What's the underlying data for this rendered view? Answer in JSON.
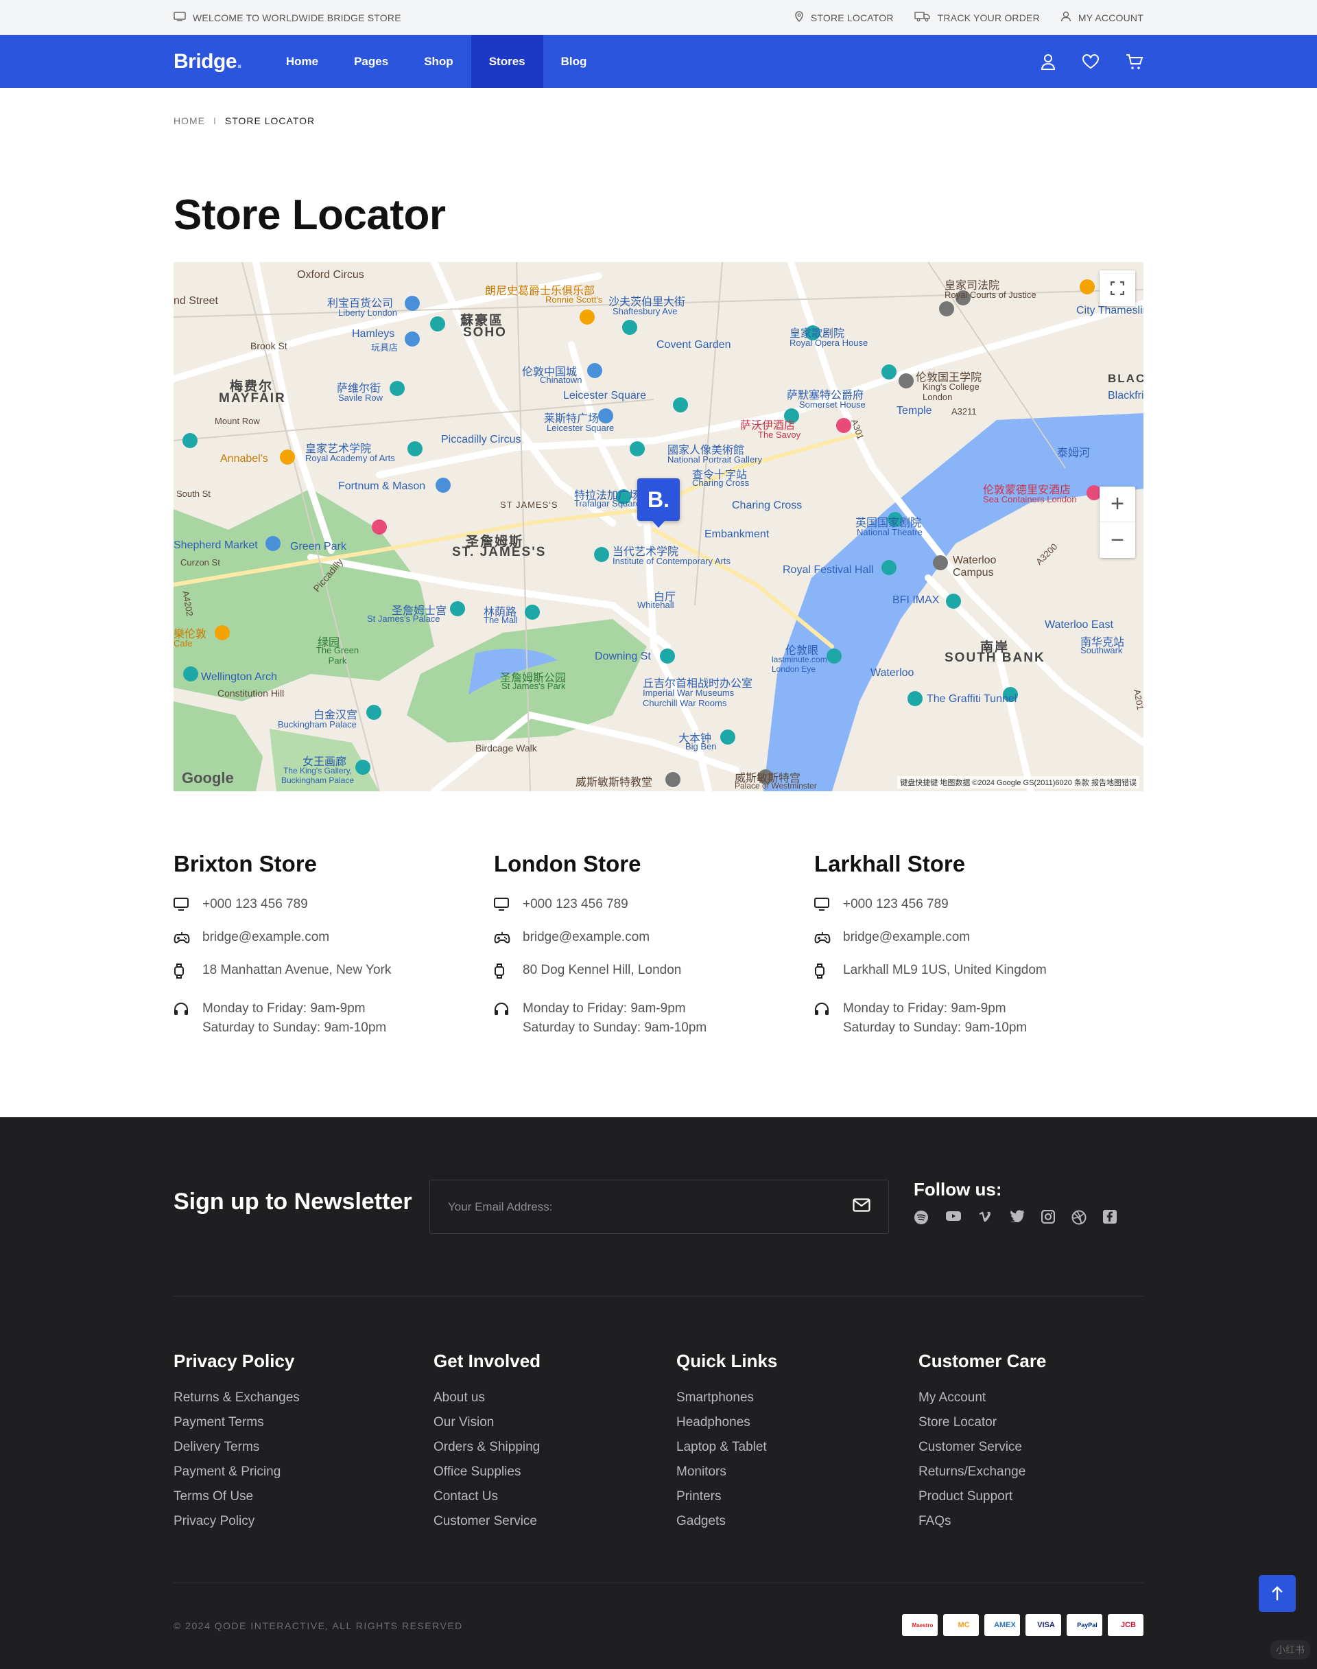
{
  "topbar": {
    "welcome": "WELCOME TO WORLDWIDE BRIDGE STORE",
    "store_locator": "STORE LOCATOR",
    "track_order": "TRACK YOUR ORDER",
    "my_account": "MY ACCOUNT"
  },
  "nav": {
    "logo": "Bridge",
    "logo_dot": ".",
    "items": [
      {
        "label": "Home"
      },
      {
        "label": "Pages"
      },
      {
        "label": "Shop"
      },
      {
        "label": "Stores",
        "active": true
      },
      {
        "label": "Blog"
      }
    ]
  },
  "breadcrumb": {
    "home": "HOME",
    "separator": "I",
    "current": "STORE LOCATOR"
  },
  "page_title": "Store Locator",
  "map": {
    "marker": "B.",
    "attribution": "键盘快捷键   地图数据 ©2024 Google GS(2011)6020   条款   报告地图错误",
    "logo": "Google",
    "zoom_in": "+",
    "zoom_out": "−",
    "labels": {
      "soho_cn": "蘇豪區",
      "soho": "SOHO",
      "mayfair_cn": "梅费尔",
      "mayfair": "MAYFAIR",
      "stjames_cn": "圣詹姆斯",
      "stjames": "ST. JAMES'S",
      "southbank_cn": "南岸",
      "southbank": "SOUTH BANK",
      "oxford": "Oxford Circus",
      "liberty_cn": "利宝百货公司",
      "liberty": "Liberty London",
      "ronnie_cn": "朗尼史葛爵士乐俱乐部",
      "ronnie": "Ronnie Scott's",
      "shaftesbury_cn": "沙夫茨伯里大街",
      "shaftesbury": "Shaftesbury Ave",
      "covent": "Covent Garden",
      "opera_cn": "皇家歌剧院",
      "opera": "Royal Opera House",
      "hamleys": "Hamleys",
      "hamleys_cn": "玩具店",
      "chinatown_cn": "伦敦中国城",
      "chinatown": "Chinatown",
      "leicester": "Leicester Square",
      "savile_cn": "萨维尔街",
      "savile": "Savile Row",
      "laimeng_cn": "莱斯特广场",
      "laimeng": "Leicester Square",
      "savoy_cn": "萨沃伊酒店",
      "savoy": "The Savoy",
      "somerset_cn": "萨默塞特公爵府",
      "somerset": "Somerset House",
      "kings_cn": "伦敦国王学院",
      "kings": "King's College London",
      "temple": "Temple",
      "ra_cn": "皇家艺术学院",
      "ra": "Royal Academy of Arts",
      "piccadilly": "Piccadilly Circus",
      "npg_cn": "國家人像美術館",
      "npg": "National Portrait Gallery",
      "charing_cn": "查令十字站",
      "charing": "Charing Cross",
      "charing2": "Charing Cross",
      "annabels": "Annabel's",
      "fortnum": "Fortnum & Mason",
      "trafalgar_cn": "特拉法加广场",
      "trafalgar": "Trafalgar Square",
      "stjames_st": "ST JAMES'S",
      "embankment": "Embankment",
      "thames_cn": "泰姆河",
      "seacontainers_cn": "伦敦蒙德里安酒店",
      "seacontainers": "Sea Containers London",
      "nt_cn": "英国国家剧院",
      "nt": "National Theatre",
      "shepherd": "Shepherd Market",
      "greenpark": "Green Park",
      "ica_cn": "当代艺术学院",
      "ica": "Institute of Contemporary Arts",
      "rfh": "Royal Festival Hall",
      "waterloo_campus": "Waterloo Campus",
      "bfi": "BFI IMAX",
      "whitehall_cn": "白厅",
      "whitehall": "Whitehall",
      "stjp_cn": "圣詹姆士宫",
      "stjp": "St James's Palace",
      "mall_cn": "林荫路",
      "mall": "The Mall",
      "greenpark_cn": "绿园",
      "greenpark2": "The Green Park",
      "waterloo_east": "Waterloo East",
      "southwark_cn": "南华克站",
      "southwark": "Southwark",
      "downing": "Downing St",
      "londoneye_cn": "伦敦眼",
      "londoneye": "lastminute.com London Eye",
      "waterloo": "Waterloo",
      "wellington": "Wellington Arch",
      "constitution": "Constitution Hill",
      "stjpark_cn": "圣詹姆斯公园",
      "stjpark": "St James's Park",
      "churchill_cn": "丘吉尔首相战时办公室",
      "churchill": "Imperial War Museums Churchill War Rooms",
      "graffiti": "The Graffiti Tunnel",
      "buckingham_cn": "白金汉宫",
      "buckingham": "Buckingham Palace",
      "bigben_cn": "大本钟",
      "bigben": "Big Ben",
      "queens_cn": "女王画廊",
      "queens": "The King's Gallery, Buckingham Palace",
      "birdcage": "Birdcage Walk",
      "abbey_cn": "威斯敏斯特教堂",
      "palace_cn": "威斯敏斯特宫",
      "palace": "Palace of Westminster",
      "court_cn": "皇家司法院",
      "court": "Royal Courts of Justice",
      "citythames": "City Thameslink",
      "blackfriars": "BLAC",
      "blackfriars2": "Blackfri",
      "lechun_cn": "樂伦敦",
      "lechun": "Cafe",
      "oxst": "nd Street",
      "brook": "Brook St",
      "mount": "Mount Row",
      "southst": "South St",
      "curzon": "Curzon St",
      "piccadilly_rd": "Piccadilly",
      "a4202": "A4202",
      "a3211": "A3211",
      "a301": "A301",
      "a3200": "A3200",
      "a201": "A201"
    }
  },
  "stores": [
    {
      "name": "Brixton Store",
      "phone": "+000 123 456 789",
      "email": "bridge@example.com",
      "address": "18 Manhattan Avenue, New York",
      "hours1": "Monday to Friday: 9am-9pm",
      "hours2": "Saturday to Sunday: 9am-10pm"
    },
    {
      "name": "London Store",
      "phone": "+000 123 456 789",
      "email": "bridge@example.com",
      "address": "80 Dog Kennel Hill, London",
      "hours1": "Monday to Friday: 9am-9pm",
      "hours2": "Saturday to Sunday: 9am-10pm"
    },
    {
      "name": "Larkhall Store",
      "phone": "+000 123 456 789",
      "email": "bridge@example.com",
      "address": "Larkhall ML9 1US, United Kingdom",
      "hours1": "Monday to Friday: 9am-9pm",
      "hours2": "Saturday to Sunday: 9am-10pm"
    }
  ],
  "newsletter": {
    "title": "Sign up to Newsletter",
    "placeholder": "Your Email Address:"
  },
  "follow": {
    "title": "Follow us:",
    "icons": [
      "spotify-icon",
      "youtube-icon",
      "vimeo-icon",
      "twitter-icon",
      "instagram-icon",
      "dribbble-icon",
      "facebook-icon"
    ]
  },
  "footer_cols": [
    {
      "title": "Privacy Policy",
      "links": [
        "Returns & Exchanges",
        "Payment Terms",
        "Delivery Terms",
        "Payment & Pricing",
        "Terms Of Use",
        "Privacy Policy"
      ]
    },
    {
      "title": "Get Involved",
      "links": [
        "About us",
        "Our Vision",
        "Orders & Shipping",
        "Office Supplies",
        "Contact Us",
        "Customer Service"
      ]
    },
    {
      "title": "Quick Links",
      "links": [
        "Smartphones",
        "Headphones",
        "Laptop & Tablet",
        "Monitors",
        "Printers",
        "Gadgets"
      ]
    },
    {
      "title": "Customer Care",
      "links": [
        "My Account",
        "Store Locator",
        "Customer Service",
        "Returns/Exchange",
        "Product Support",
        "FAQs"
      ]
    }
  ],
  "copyright": "© 2024 QODE INTERACTIVE, ALL RIGHTS RESERVED",
  "payments": [
    "Maestro",
    "MC",
    "AMEX",
    "VISA",
    "PayPal",
    "JCB"
  ],
  "watermark": "小红书",
  "colors": {
    "brand": "#2b55dd",
    "footer_bg": "#1f1f21",
    "water": "#8ab4f8",
    "park": "#a8d5a2"
  }
}
